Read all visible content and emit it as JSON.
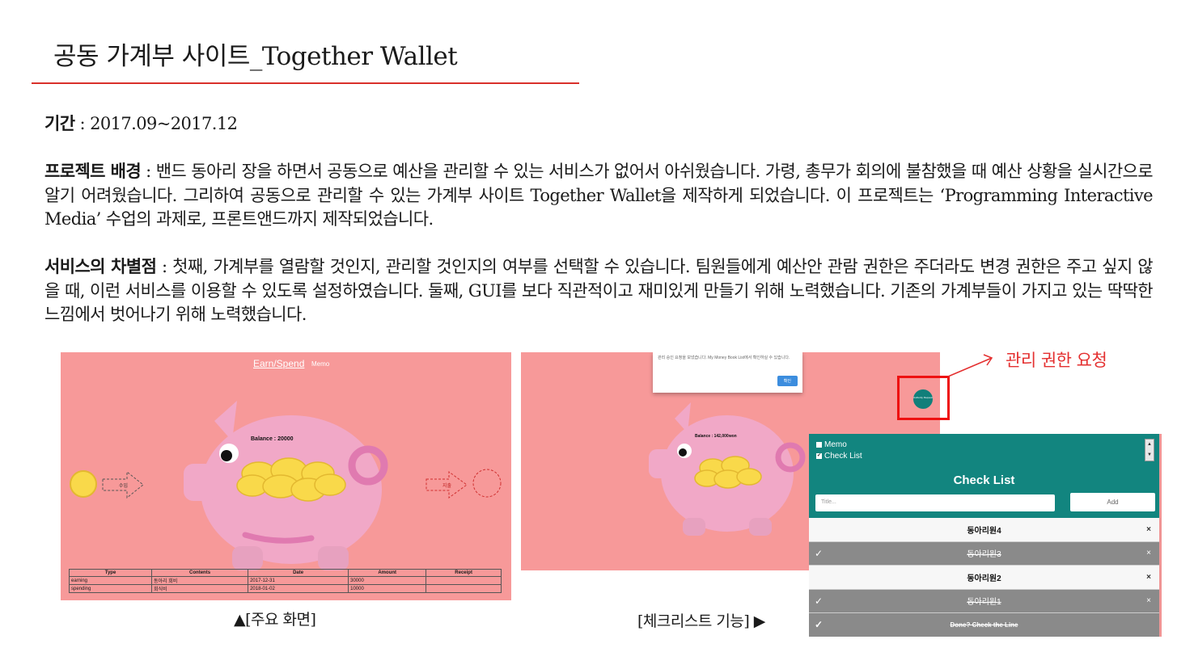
{
  "title": "공동 가계부 사이트_Together Wallet",
  "period": {
    "label": "기간",
    "value": " : 2017.09~2017.12"
  },
  "background": {
    "label": "프로젝트 배경",
    "text": " : 밴드 동아리 장을 하면서 공동으로 예산을 관리할 수 있는 서비스가 없어서 아쉬웠습니다. 가령, 총무가 회의에 불참했을 때 예산 상황을 실시간으로 알기 어려웠습니다. 그리하여 공동으로 관리할 수 있는 가계부 사이트 Together Wallet을 제작하게 되었습니다. 이 프로젝트는 ‘Programming Interactive Media’ 수업의 과제로, 프론트앤드까지 제작되었습니다."
  },
  "differentiation": {
    "label": "서비스의 차별점",
    "text": " : 첫째, 가계부를 열람할 것인지, 관리할 것인지의 여부를 선택할 수 있습니다. 팀원들에게 예산안 관람 권한은 주더라도 변경 권한은 주고 싶지 않을 때, 이런 서비스를 이용할 수 있도록 설정하였습니다. 둘째, GUI를 보다 직관적이고 재미있게 만들기 위해 노력했습니다. 기존의 가계부들이 가지고 있는 딱딱한 느낌에서 벗어나기 위해 노력했습니다."
  },
  "main_screen": {
    "tab_earn": "Earn/Spend",
    "tab_memo": "Memo",
    "balance": "Balance : 20000",
    "income_label": "수입",
    "expense_label": "지출",
    "table": {
      "headers": [
        "Type",
        "Contents",
        "Date",
        "Amount",
        "Receipt"
      ],
      "rows": [
        [
          "earning",
          "동아리 회비",
          "2017-12-31",
          "30000",
          ""
        ],
        [
          "spending",
          "회식비",
          "2018-01-02",
          "10000",
          ""
        ]
      ]
    }
  },
  "request_screen": {
    "dialog_text": "관리 승인 요청을 보냈습니다. My Money Book List에서 확인하실 수 있습니다.",
    "dialog_button": "확인",
    "balance": "Balance : 142,000won",
    "fab_label": "Authority Request"
  },
  "annotation": {
    "request_label": "관리 권한 요청"
  },
  "checklist": {
    "options": [
      {
        "label": "Memo",
        "checked": false
      },
      {
        "label": "Check List",
        "checked": true
      }
    ],
    "title": "Check List",
    "input_placeholder": "Title...",
    "add_label": "Add",
    "items": [
      {
        "text": "동아리원4",
        "done": false
      },
      {
        "text": "동아리원3",
        "done": true
      },
      {
        "text": "동아리원2",
        "done": false
      },
      {
        "text": "동아리원1",
        "done": true
      },
      {
        "text": "Done? Check the Line",
        "done": true
      }
    ]
  },
  "captions": {
    "main": "▲[주요 화면]",
    "checklist": "[체크리스트 기능] ▶"
  },
  "colors": {
    "accent_red": "#d9302a",
    "panel_pink": "#f79999",
    "teal": "#12857f",
    "pig": "#f1a8c7",
    "coin": "#f9d94a"
  }
}
